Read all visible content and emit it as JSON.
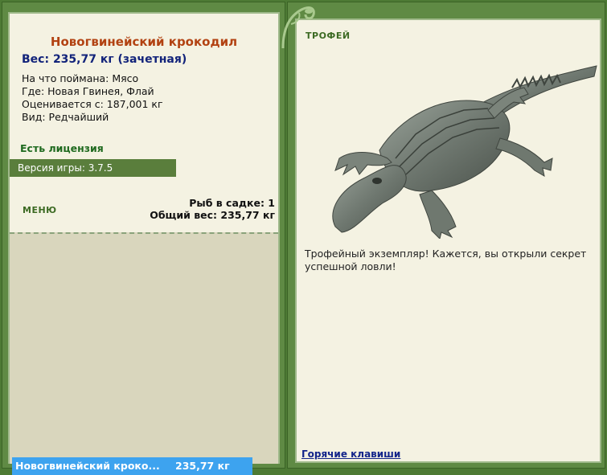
{
  "fish": {
    "title": "Новогвинейский крокодил",
    "weight": "Вес: 235,77 кг (зачетная)",
    "bait": "На что поймана: Мясо",
    "location": "Где: Новая Гвинея, Флай",
    "rated_from": "Оценивается с: 187,001 кг",
    "kind": "Вид: Редчайший"
  },
  "license": "Есть лицензия",
  "version": "Версия игры: 3.7.5",
  "menu_label": "МЕНЮ",
  "sadok": {
    "count": "Рыб в садке: 1",
    "total": "Общий вес: 235,77 кг"
  },
  "list": [
    {
      "name": "Новогвинейский кроко...",
      "weight": "235,77 кг"
    }
  ],
  "trophy": {
    "label": "ТРОФЕЙ",
    "text": "Трофейный экземпляр! Кажется, вы открыли секрет успешной ловли!"
  },
  "hotkeys": "Горячие клавиши",
  "colors": {
    "panel_bg": "#f4f2e2",
    "frame_green": "#5f8a44",
    "selection": "#3da3ef",
    "title_orange": "#b24212"
  }
}
